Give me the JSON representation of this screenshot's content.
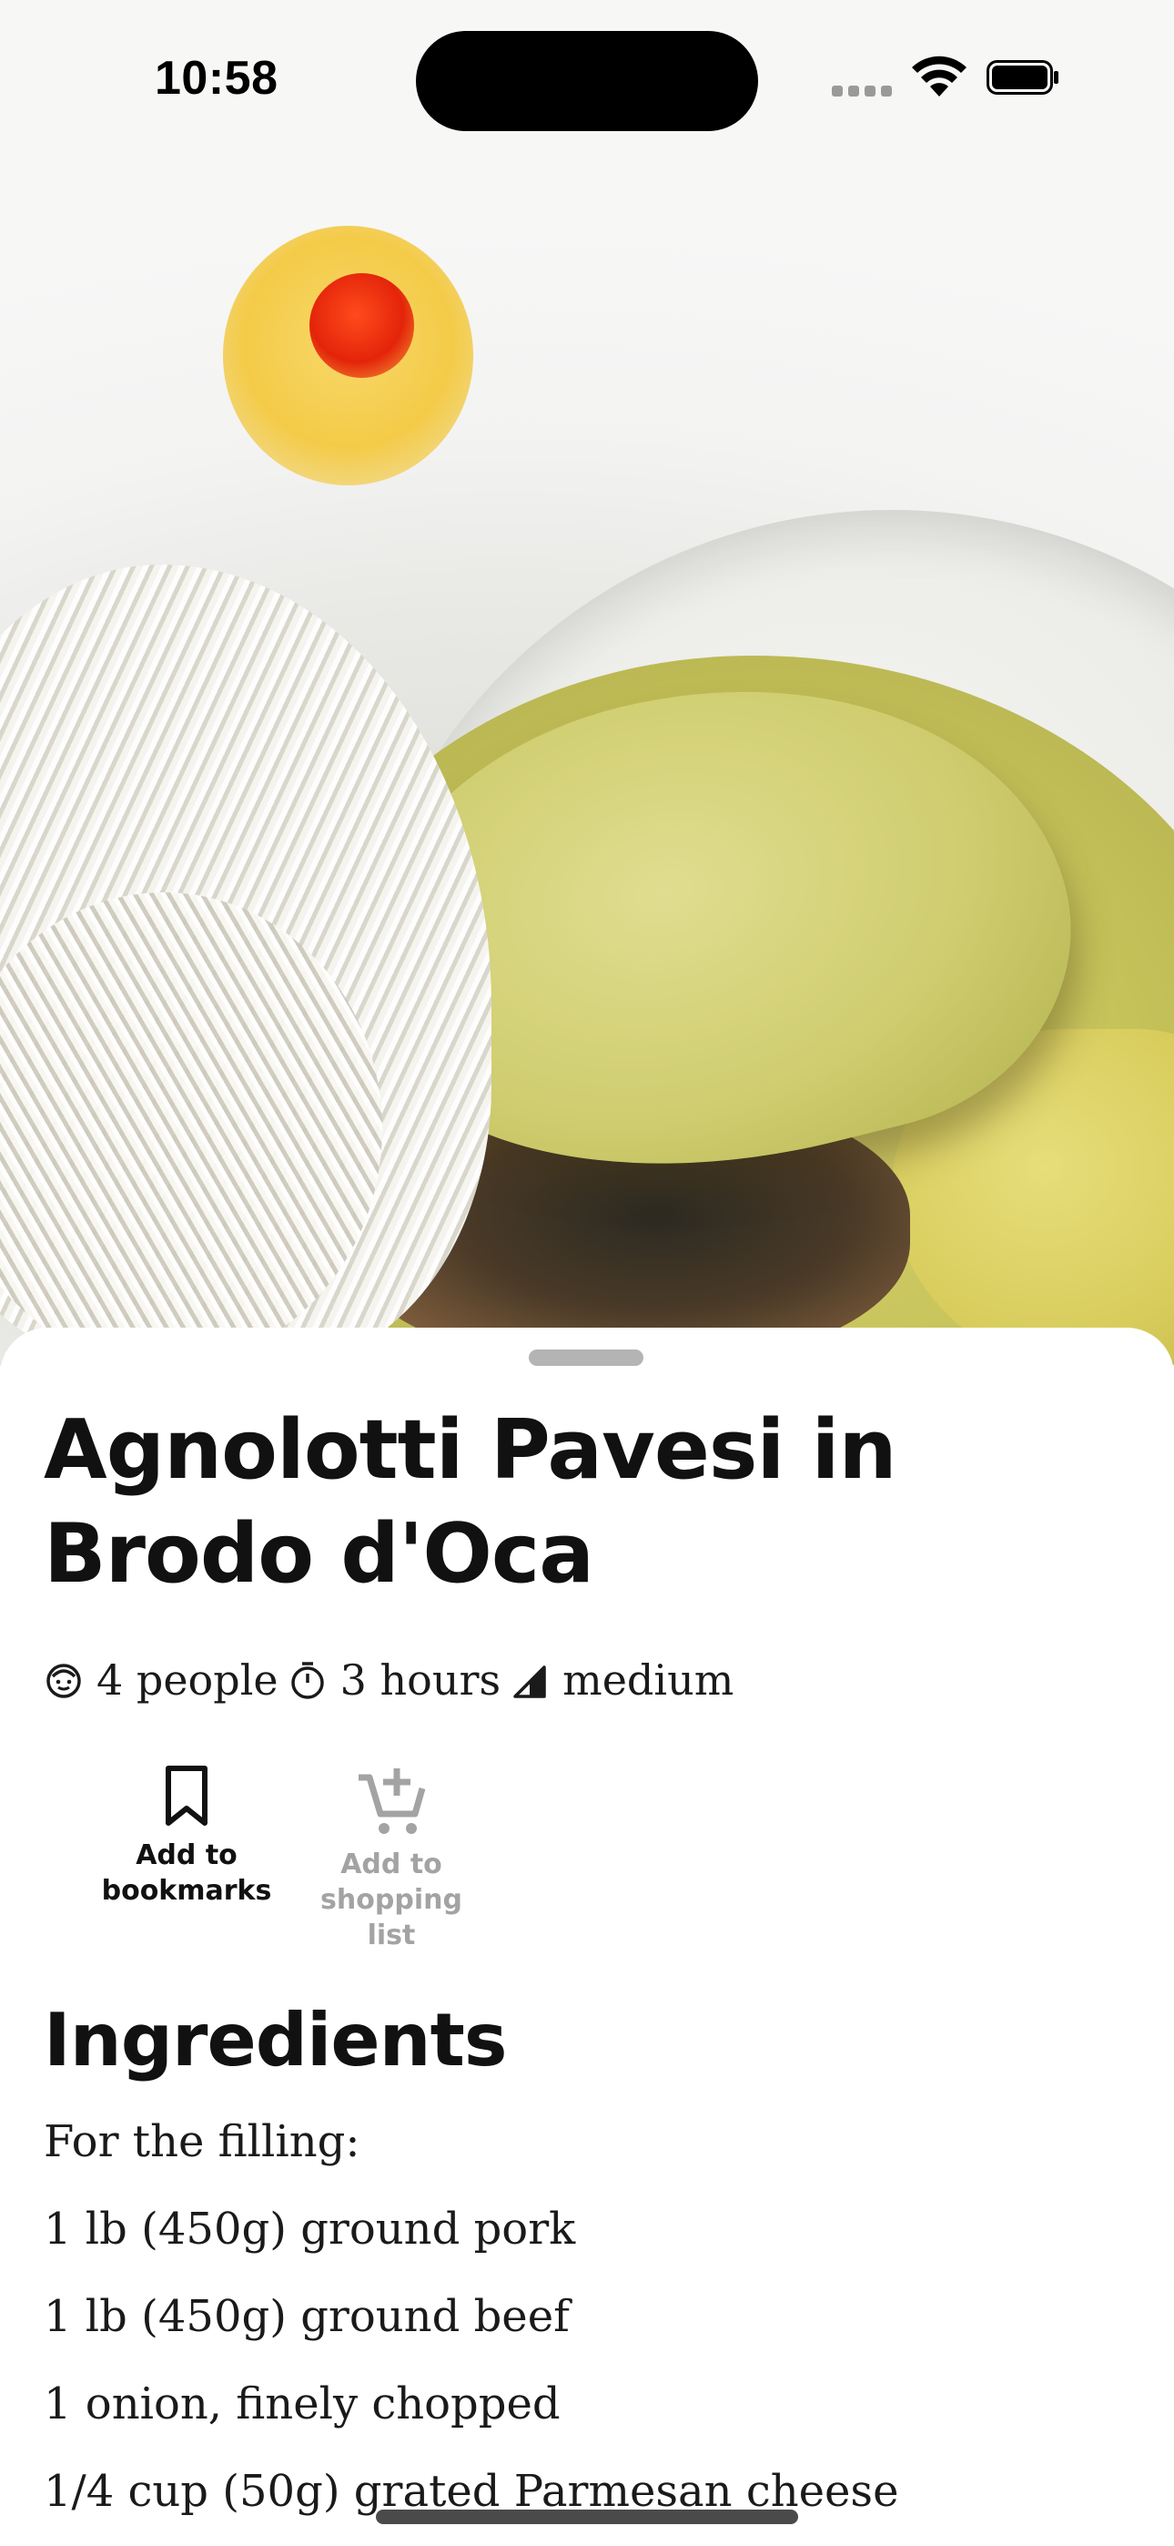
{
  "status_bar": {
    "time": "10:58"
  },
  "hero": {
    "icon": "recipe-photo"
  },
  "recipe": {
    "title": "Agnolotti Pavesi in Brodo d'Oca",
    "servings": "4 people",
    "duration": "3 hours",
    "difficulty": "medium"
  },
  "actions": {
    "bookmark_label": "Add to bookmarks",
    "shopping_label": "Add to shopping list",
    "shopping_state": "disabled"
  },
  "ingredients": {
    "heading": "Ingredients",
    "items": [
      "For the filling:",
      "1 lb (450g) ground pork",
      "1 lb (450g) ground beef",
      "1 onion, finely chopped",
      "1/4 cup (50g) grated Parmesan cheese"
    ]
  },
  "colors": {
    "text": "#111111",
    "disabled": "#a3a3a3",
    "sheet": "#ffffff"
  }
}
